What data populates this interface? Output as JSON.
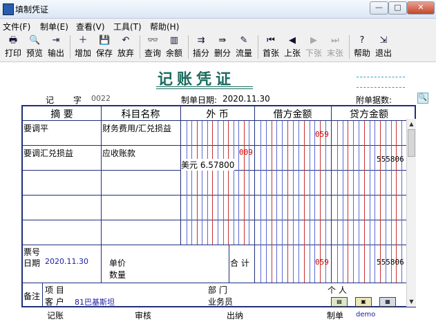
{
  "window": {
    "title": "填制凭证",
    "buttons": [
      "—",
      "□",
      "✕"
    ]
  },
  "menu": [
    "文件(F)",
    "制单(E)",
    "查看(V)",
    "工具(T)",
    "帮助(H)"
  ],
  "toolbar": [
    {
      "label": "打印",
      "icon": "print-icon",
      "glyph": "🖶",
      "enabled": true
    },
    {
      "label": "预览",
      "icon": "preview-icon",
      "glyph": "🔍",
      "enabled": true
    },
    {
      "label": "输出",
      "icon": "export-icon",
      "glyph": "⇥",
      "enabled": true
    },
    {
      "label": "增加",
      "icon": "add-icon",
      "glyph": "＋",
      "enabled": true
    },
    {
      "label": "保存",
      "icon": "save-icon",
      "glyph": "💾",
      "enabled": true
    },
    {
      "label": "放弃",
      "icon": "undo-icon",
      "glyph": "↶",
      "enabled": true
    },
    {
      "label": "查询",
      "icon": "query-icon",
      "glyph": "👓",
      "enabled": true
    },
    {
      "label": "余额",
      "icon": "balance-chart-icon",
      "glyph": "▥",
      "enabled": true
    },
    {
      "label": "插分",
      "icon": "insert-row-icon",
      "glyph": "⇉",
      "enabled": true
    },
    {
      "label": "删分",
      "icon": "delete-row-icon",
      "glyph": "⇛",
      "enabled": true
    },
    {
      "label": "流量",
      "icon": "flow-icon",
      "glyph": "✎",
      "enabled": true
    },
    {
      "label": "首张",
      "icon": "first-icon",
      "glyph": "⏮",
      "enabled": true
    },
    {
      "label": "上张",
      "icon": "prev-icon",
      "glyph": "◀",
      "enabled": true
    },
    {
      "label": "下张",
      "icon": "next-icon",
      "glyph": "▶",
      "enabled": false
    },
    {
      "label": "末张",
      "icon": "last-icon",
      "glyph": "⏭",
      "enabled": false
    },
    {
      "label": "帮助",
      "icon": "help-icon",
      "glyph": "?",
      "enabled": true
    },
    {
      "label": "退出",
      "icon": "exit-icon",
      "glyph": "⇲",
      "enabled": true
    }
  ],
  "voucher": {
    "title": "记账凭证",
    "type_label": "记",
    "zi": "字",
    "number": "0022",
    "date_label": "制单日期:",
    "date": "2020.11.30",
    "attach_label": "附单据数:",
    "headers": [
      "摘 要",
      "科目名称",
      "外 币",
      "借方金额",
      "贷方金额"
    ],
    "rows": [
      {
        "summary": "要调平",
        "account": "财务费用/汇兑损益",
        "fx_amount": "",
        "fx_rate": "",
        "debit": "059",
        "credit": ""
      },
      {
        "summary": "要调汇兑损益",
        "account": "应收账款",
        "fx_amount": "009",
        "fx_rate": "美元 6.57800",
        "debit": "",
        "credit": "555806"
      }
    ],
    "bill_label": "票号",
    "bill_date_label": "日期",
    "bill_date": "2020.11.30",
    "unit_price_label": "单价",
    "quantity_label": "数量",
    "total_label": "合 计",
    "total_debit": "059",
    "total_credit": "555806",
    "remarks_label": "备注",
    "project_label": "项 目",
    "department_label": "部 门",
    "person_label": "个 人",
    "customer_label": "客 户",
    "customer_value": "81巴基斯坦",
    "salesman_label": "业务员"
  },
  "footer": {
    "bookkeeping": "记账",
    "review": "审核",
    "cashier": "出纳",
    "maker_label": "制单",
    "maker": "demo"
  }
}
